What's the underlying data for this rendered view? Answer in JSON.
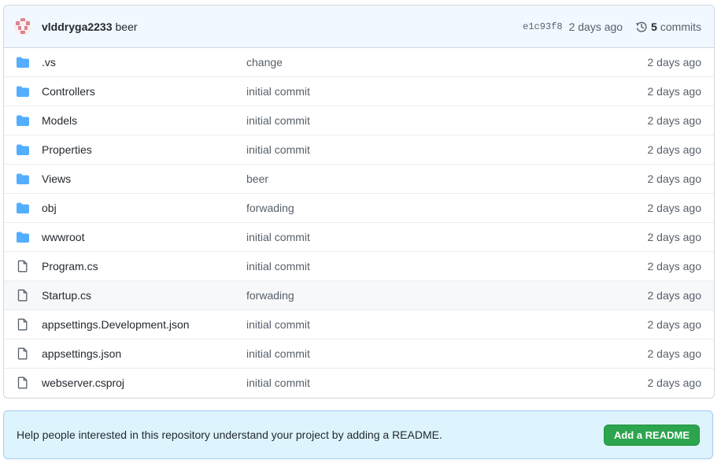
{
  "latest_commit": {
    "author": "vlddryga2233",
    "message": "beer",
    "sha": "e1c93f8",
    "age": "2 days ago",
    "commits_count": "5",
    "commits_label": "commits"
  },
  "files": [
    {
      "name": ".vs",
      "type": "folder",
      "message": "change",
      "age": "2 days ago"
    },
    {
      "name": "Controllers",
      "type": "folder",
      "message": "initial commit",
      "age": "2 days ago"
    },
    {
      "name": "Models",
      "type": "folder",
      "message": "initial commit",
      "age": "2 days ago"
    },
    {
      "name": "Properties",
      "type": "folder",
      "message": "initial commit",
      "age": "2 days ago"
    },
    {
      "name": "Views",
      "type": "folder",
      "message": "beer",
      "age": "2 days ago"
    },
    {
      "name": "obj",
      "type": "folder",
      "message": "forwading",
      "age": "2 days ago"
    },
    {
      "name": "wwwroot",
      "type": "folder",
      "message": "initial commit",
      "age": "2 days ago"
    },
    {
      "name": "Program.cs",
      "type": "file",
      "message": "initial commit",
      "age": "2 days ago"
    },
    {
      "name": "Startup.cs",
      "type": "file",
      "message": "forwading",
      "age": "2 days ago"
    },
    {
      "name": "appsettings.Development.json",
      "type": "file",
      "message": "initial commit",
      "age": "2 days ago"
    },
    {
      "name": "appsettings.json",
      "type": "file",
      "message": "initial commit",
      "age": "2 days ago"
    },
    {
      "name": "webserver.csproj",
      "type": "file",
      "message": "initial commit",
      "age": "2 days ago"
    }
  ],
  "readme": {
    "text": "Help people interested in this repository understand your project by adding a README.",
    "button": "Add a README"
  },
  "colors": {
    "folder": "#54aeff",
    "file_icon": "#57606a",
    "button": "#2da44e",
    "header_bg": "#f1f8ff",
    "readme_bg": "#ddf4ff"
  }
}
